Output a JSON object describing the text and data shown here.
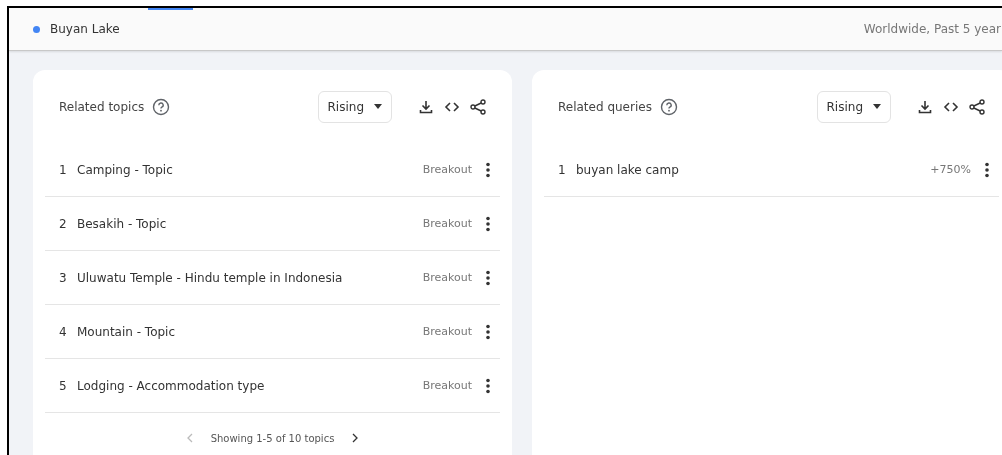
{
  "header": {
    "term": {
      "label": "Buyan Lake",
      "color": "#4285f4"
    },
    "scope": "Worldwide, Past 5 year"
  },
  "panels": [
    {
      "title": "Related topics",
      "filter": "Rising",
      "rows": [
        {
          "rank": "1",
          "label": "Camping - Topic",
          "value": "Breakout"
        },
        {
          "rank": "2",
          "label": "Besakih - Topic",
          "value": "Breakout"
        },
        {
          "rank": "3",
          "label": "Uluwatu Temple - Hindu temple in Indonesia",
          "value": "Breakout"
        },
        {
          "rank": "4",
          "label": "Mountain - Topic",
          "value": "Breakout"
        },
        {
          "rank": "5",
          "label": "Lodging - Accommodation type",
          "value": "Breakout"
        }
      ],
      "pagination": "Showing 1-5 of 10 topics"
    },
    {
      "title": "Related queries",
      "filter": "Rising",
      "rows": [
        {
          "rank": "1",
          "label": "buyan lake camp",
          "value": "+750%"
        }
      ]
    }
  ]
}
